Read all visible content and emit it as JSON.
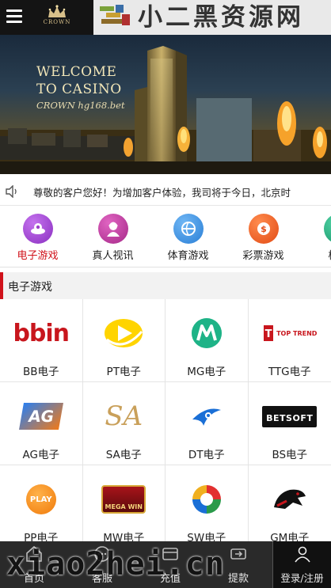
{
  "header": {
    "logo_text": "CROWN",
    "brand_text": "小二黑资源网"
  },
  "banner": {
    "title_line1": "WELCOME",
    "title_line2": "TO CASINO",
    "subtitle": "CROWN hg168.bet"
  },
  "notice": {
    "text": "尊敬的客户您好！为增加客户体验，我司将于今日，北京时"
  },
  "tabs": [
    {
      "label": "电子游戏",
      "active": true,
      "icon": "slot-machine-icon",
      "color": "#9b3fc9"
    },
    {
      "label": "真人视讯",
      "active": false,
      "icon": "live-dealer-icon",
      "color": "#b8359a"
    },
    {
      "label": "体育游戏",
      "active": false,
      "icon": "sports-ball-icon",
      "color": "#3a8de0"
    },
    {
      "label": "彩票游戏",
      "active": false,
      "icon": "lottery-icon",
      "color": "#f0612a"
    },
    {
      "label": "棋牌",
      "active": false,
      "icon": "cards-icon",
      "color": "#1fae80"
    }
  ],
  "section": {
    "title": "电子游戏"
  },
  "games": [
    {
      "label": "BB电子",
      "logo": "bbin",
      "logo_text": "bbin"
    },
    {
      "label": "PT电子",
      "logo": "pt",
      "logo_text": ""
    },
    {
      "label": "MG电子",
      "logo": "mg",
      "logo_text": ""
    },
    {
      "label": "TTG电子",
      "logo": "ttg",
      "logo_text": "TOP TREND"
    },
    {
      "label": "AG电子",
      "logo": "ag",
      "logo_text": "AG"
    },
    {
      "label": "SA电子",
      "logo": "sa",
      "logo_text": "SA"
    },
    {
      "label": "DT电子",
      "logo": "dt",
      "logo_text": ""
    },
    {
      "label": "BS电子",
      "logo": "bs",
      "logo_text": "BETSOFT"
    },
    {
      "label": "PP电子",
      "logo": "pp",
      "logo_text": "PLAY"
    },
    {
      "label": "MW电子",
      "logo": "mw",
      "logo_text": "MEGA WIN"
    },
    {
      "label": "SW电子",
      "logo": "sw",
      "logo_text": ""
    },
    {
      "label": "GM电子",
      "logo": "gm",
      "logo_text": ""
    }
  ],
  "bottom_nav": [
    {
      "label": "首页",
      "icon": "home-icon"
    },
    {
      "label": "客服",
      "icon": "chat-icon"
    },
    {
      "label": "充值",
      "icon": "wallet-icon"
    },
    {
      "label": "提款",
      "icon": "withdraw-icon"
    },
    {
      "label": "登录/注册",
      "icon": "user-icon"
    }
  ],
  "watermark": "xiao2hei.cn",
  "colors": {
    "accent": "#d0121b",
    "header_bg": "#141414",
    "nav_bg": "#2a2a2a"
  }
}
